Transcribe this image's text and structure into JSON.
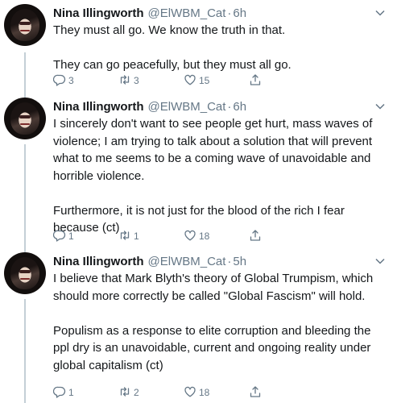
{
  "tweets": [
    {
      "name": "Nina Illingworth",
      "handle": "@ElWBM_Cat",
      "time": "6h",
      "paragraphs": [
        "They must all go. We know the truth in that.",
        "They can go peacefully, but they must all go."
      ],
      "replies": "3",
      "retweets": "3",
      "likes": "15"
    },
    {
      "name": "Nina Illingworth",
      "handle": "@ElWBM_Cat",
      "time": "6h",
      "paragraphs": [
        "I sincerely don't want to see people get hurt, mass waves of violence; I am trying to talk about a solution that will prevent what to me seems to be a coming wave of unavoidable and horrible violence.",
        "Furthermore, it is not just for the blood of the rich I fear because (ct)"
      ],
      "replies": "1",
      "retweets": "1",
      "likes": "18"
    },
    {
      "name": "Nina Illingworth",
      "handle": "@ElWBM_Cat",
      "time": "5h",
      "paragraphs": [
        "I believe that Mark Blyth's theory of Global Trumpism, which should more correctly be called \"Global Fascism\" will hold.",
        "Populism as a response to elite corruption and bleeding the ppl dry is an unavoidable, current and ongoing reality under global capitalism (ct)"
      ],
      "replies": "1",
      "retweets": "2",
      "likes": "18"
    }
  ],
  "separator": "·",
  "icons": {
    "reply": "reply-icon",
    "retweet": "retweet-icon",
    "like": "heart-icon",
    "share": "share-icon",
    "menu": "chevron-down-icon"
  },
  "colors": {
    "text": "#14171a",
    "muted": "#657786",
    "thread_line": "#c4cfd6"
  }
}
